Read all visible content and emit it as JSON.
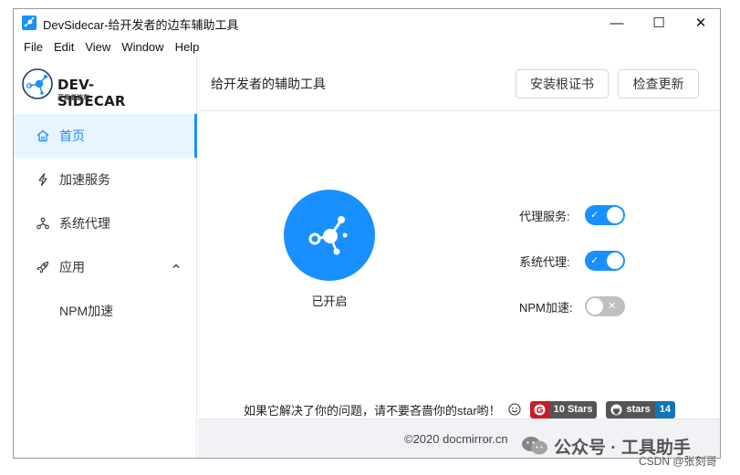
{
  "window": {
    "title": "DevSidecar-给开发者的边车辅助工具",
    "controls": {
      "minimize": "—",
      "maximize": "☐",
      "close": "✕"
    }
  },
  "menubar": [
    "File",
    "Edit",
    "View",
    "Window",
    "Help"
  ],
  "logo": {
    "name": "DEV-SIDECAR",
    "subtitle": "开发者边车"
  },
  "sidebar": {
    "items": [
      {
        "label": "首页",
        "icon": "home-icon",
        "active": true
      },
      {
        "label": "加速服务",
        "icon": "thunderbolt-icon"
      },
      {
        "label": "系统代理",
        "icon": "network-icon"
      },
      {
        "label": "应用",
        "icon": "rocket-icon",
        "expanded": true
      },
      {
        "label": "NPM加速",
        "sub": true
      }
    ]
  },
  "header": {
    "title": "给开发者的辅助工具",
    "install_cert_label": "安装根证书",
    "check_update_label": "检查更新"
  },
  "main": {
    "status_label": "已开启",
    "switches": [
      {
        "label": "代理服务:",
        "on": true,
        "mark": "✓"
      },
      {
        "label": "系统代理:",
        "on": true,
        "mark": "✓"
      },
      {
        "label": "NPM加速:",
        "on": false,
        "mark": "✕"
      }
    ],
    "promo_text": "如果它解决了你的问题，请不要吝啬你的star哟！",
    "gitee_badge": {
      "left": "G",
      "right": "10 Stars"
    },
    "github_badge": {
      "left": "stars",
      "right": "14"
    }
  },
  "footer": {
    "copyright": "©2020 docmirror.cn"
  },
  "overlay": {
    "wechat_watermark": "公众号 · 工具助手",
    "csdn_watermark": "CSDN @张刻哥"
  },
  "colors": {
    "accent": "#1890ff",
    "gitee": "#c71d23",
    "github_count": "#1074b7"
  }
}
